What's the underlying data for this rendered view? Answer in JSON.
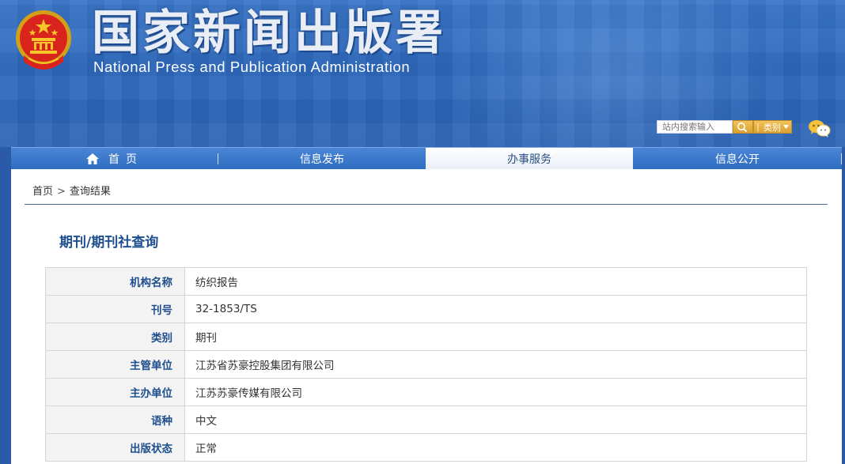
{
  "header": {
    "title": "国家新闻出版署",
    "subtitle": "National Press and Publication Administration",
    "search_placeholder": "站内搜索输入",
    "category_label": "类别"
  },
  "nav": {
    "items": [
      {
        "label": "首页"
      },
      {
        "label": "信息发布"
      },
      {
        "label": "办事服务",
        "active": true
      },
      {
        "label": "信息公开"
      }
    ]
  },
  "breadcrumb": {
    "home": "首页",
    "separator": ">",
    "current": "查询结果"
  },
  "page_title": "期刊/期刊社查询",
  "table": {
    "rows": [
      {
        "label": "机构名称",
        "value": "纺织报告"
      },
      {
        "label": "刊号",
        "value": "32-1853/TS"
      },
      {
        "label": "类别",
        "value": "期刊"
      },
      {
        "label": "主管单位",
        "value": "江苏省苏豪控股集团有限公司"
      },
      {
        "label": "主办单位",
        "value": "江苏苏豪传媒有限公司"
      },
      {
        "label": "语种",
        "value": "中文"
      },
      {
        "label": "出版状态",
        "value": "正常"
      }
    ]
  },
  "colors": {
    "header_blue": "#2d68bc",
    "label_blue": "#1f4f8e",
    "search_button_gold": "#d9a032"
  },
  "icons": {
    "emblem": "national-emblem-icon",
    "home": "home-icon",
    "search": "search-icon",
    "dropdown": "caret-down-icon",
    "wechat": "wechat-icon"
  }
}
